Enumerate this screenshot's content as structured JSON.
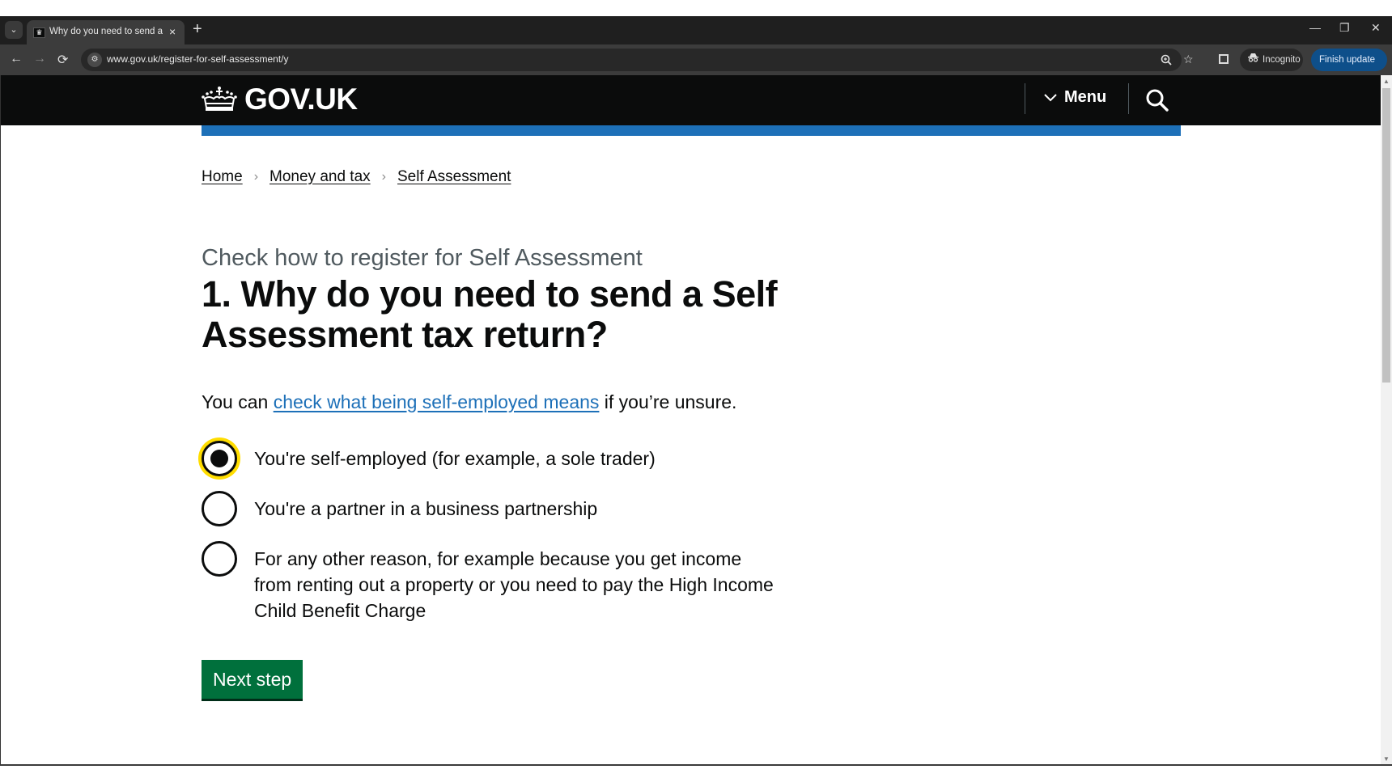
{
  "browser": {
    "tab_title": "Why do you need to send a Self Assessment tax return?",
    "tab_title_visible": "Why do you need to send a Sel",
    "url": "www.gov.uk/register-for-self-assessment/y",
    "incognito_label": "Incognito",
    "finish_update_label": "Finish update",
    "new_tab": "+",
    "icons": {
      "tab_search": "⌄",
      "tab_close": "×",
      "back": "←",
      "forward": "→",
      "reload": "⟳",
      "site_info": "⚙",
      "zoom": "🔍",
      "bookmark": "☆",
      "minimize": "—",
      "restore": "❐",
      "close": "✕",
      "menu_dots": "⋮",
      "incognito": "🕶"
    }
  },
  "header": {
    "logo_text": "GOV.UK",
    "menu_label": "Menu"
  },
  "breadcrumbs": [
    {
      "label": "Home"
    },
    {
      "label": "Money and tax"
    },
    {
      "label": "Self Assessment"
    }
  ],
  "breadcrumb_separator": "›",
  "page": {
    "caption": "Check how to register for Self Assessment",
    "title": "1. Why do you need to send a Self Assessment tax return?",
    "hint_prefix": "You can ",
    "hint_link": "check what being self-employed means",
    "hint_suffix": " if you’re unsure.",
    "options": [
      {
        "label": "You're self-employed (for example, a sole trader)",
        "checked": true
      },
      {
        "label": "You're a partner in a business partnership",
        "checked": false
      },
      {
        "label": "For any other reason, for example because you get income from renting out a property or you need to pay the High Income Child Benefit Charge",
        "checked": false
      }
    ],
    "submit_label": "Next step"
  },
  "colors": {
    "header_bg": "#0b0c0c",
    "brand_blue": "#1d70b8",
    "link": "#1d70b8",
    "button_green": "#00703c",
    "focus_yellow": "#ffdd00",
    "caption_grey": "#505a5f"
  }
}
